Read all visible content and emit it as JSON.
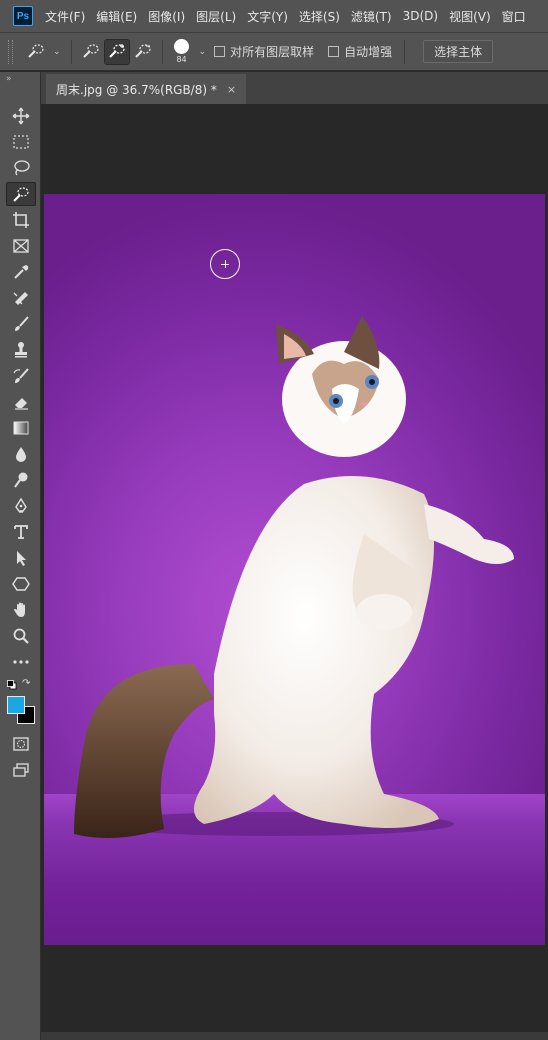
{
  "app": {
    "logo": "Ps"
  },
  "menu": {
    "items": [
      "文件(F)",
      "编辑(E)",
      "图像(I)",
      "图层(L)",
      "文字(Y)",
      "选择(S)",
      "滤镜(T)",
      "3D(D)",
      "视图(V)",
      "窗口"
    ]
  },
  "options": {
    "brush_size": "84",
    "sample_all_layers_label": "对所有图层取样",
    "auto_enhance_label": "自动增强",
    "select_subject_label": "选择主体"
  },
  "toolbox": {
    "collapse_glyph": "»",
    "tools": [
      {
        "name": "move-tool",
        "icon": "move-icon"
      },
      {
        "name": "marquee-tool",
        "icon": "rect-marquee-icon"
      },
      {
        "name": "lasso-tool",
        "icon": "lasso-icon"
      },
      {
        "name": "quick-selection-tool",
        "icon": "quick-select-icon",
        "active": true
      },
      {
        "name": "crop-tool",
        "icon": "crop-icon"
      },
      {
        "name": "frame-tool",
        "icon": "frame-icon"
      },
      {
        "name": "eyedropper-tool",
        "icon": "eyedropper-icon"
      },
      {
        "name": "healing-brush-tool",
        "icon": "bandage-icon"
      },
      {
        "name": "brush-tool",
        "icon": "brush-icon"
      },
      {
        "name": "clone-stamp-tool",
        "icon": "stamp-icon"
      },
      {
        "name": "history-brush-tool",
        "icon": "history-brush-icon"
      },
      {
        "name": "eraser-tool",
        "icon": "eraser-icon"
      },
      {
        "name": "gradient-tool",
        "icon": "gradient-icon"
      },
      {
        "name": "blur-tool",
        "icon": "drop-icon"
      },
      {
        "name": "dodge-tool",
        "icon": "dodge-icon"
      },
      {
        "name": "pen-tool",
        "icon": "pen-icon"
      },
      {
        "name": "type-tool",
        "icon": "type-icon"
      },
      {
        "name": "path-selection-tool",
        "icon": "arrow-icon"
      },
      {
        "name": "shape-tool",
        "icon": "hexagon-icon"
      },
      {
        "name": "hand-tool",
        "icon": "hand-icon"
      },
      {
        "name": "zoom-tool",
        "icon": "magnifier-icon"
      },
      {
        "name": "more-tools",
        "icon": "ellipsis-icon"
      }
    ],
    "foreground_color": "#19a7e6",
    "background_color": "#000000"
  },
  "document": {
    "tab_title": "周末.jpg @ 36.7%(RGB/8) *",
    "close_glyph": "×",
    "canvas_background": "#9a3ec0"
  }
}
